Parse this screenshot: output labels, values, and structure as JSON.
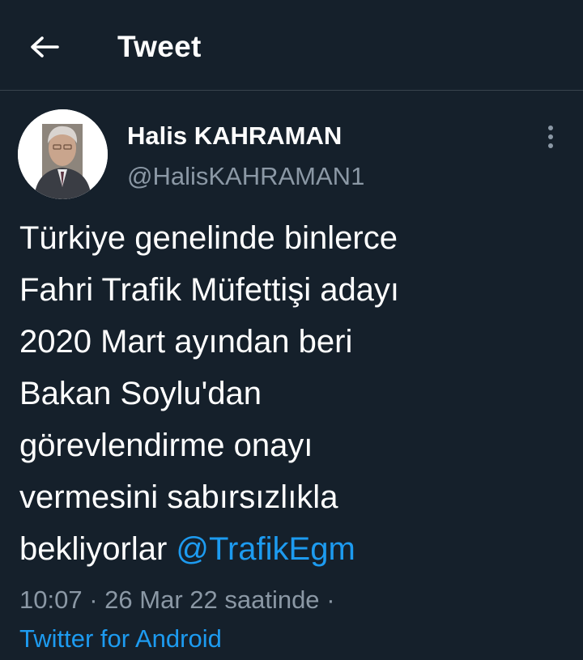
{
  "header": {
    "title": "Tweet",
    "back_icon": "arrow-left-icon"
  },
  "tweet": {
    "author": {
      "display_name": "Halis KAHRAMAN",
      "handle": "@HalisKAHRAMAN1",
      "avatar": "profile-photo"
    },
    "more_icon": "vertical-ellipsis-icon",
    "text_lines": [
      "Türkiye genelinde binlerce",
      "Fahri Trafik Müfettişi adayı",
      "2020 Mart ayından beri",
      "Bakan Soylu'dan",
      "görevlendirme onayı",
      "vermesini sabırsızlıkla"
    ],
    "last_line_text": "bekliyorlar",
    "mention": "@TrafikEgm",
    "meta": {
      "time": "10:07",
      "separator": "·",
      "date": "26 Mar 22 saatinde",
      "trailing_separator": "·"
    },
    "source": "Twitter for Android"
  },
  "colors": {
    "background": "#15202b",
    "text": "#ffffff",
    "secondary_text": "#8b98a5",
    "accent": "#1d9bf0",
    "divider": "#38444d"
  }
}
